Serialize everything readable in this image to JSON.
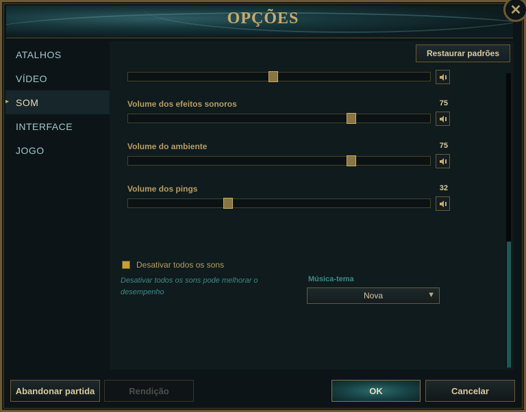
{
  "window": {
    "title": "OPÇÕES",
    "close_glyph": "✕"
  },
  "nav": {
    "items": [
      {
        "label": "ATALHOS",
        "active": false
      },
      {
        "label": "VÍDEO",
        "active": false
      },
      {
        "label": "SOM",
        "active": true
      },
      {
        "label": "INTERFACE",
        "active": false
      },
      {
        "label": "JOGO",
        "active": false
      }
    ],
    "active_marker": "▸"
  },
  "content": {
    "restore_label": "Restaurar padrões",
    "sliders": [
      {
        "label": "",
        "value": "",
        "fraction": 0.48
      },
      {
        "label": "Volume dos efeitos sonoros",
        "value": "75",
        "fraction": 0.74
      },
      {
        "label": "Volume do ambiente",
        "value": "75",
        "fraction": 0.74
      },
      {
        "label": "Volume dos pings",
        "value": "32",
        "fraction": 0.33
      }
    ],
    "mute_icon": "speaker-icon",
    "mute_all_label": "Desativar todos os sons",
    "mute_all_hint": "Desativar todos os sons pode melhorar o desempenho",
    "music_label": "Música-tema",
    "music_selected": "Nova",
    "dropdown_glyph": "▼"
  },
  "footer": {
    "abandon_label": "Abandonar partida",
    "surrender_label": "Rendição",
    "ok_label": "OK",
    "cancel_label": "Cancelar"
  },
  "colors": {
    "accent_gold": "#c8aa6e",
    "teal": "#3f8a87",
    "background": "#0f1b1d"
  }
}
